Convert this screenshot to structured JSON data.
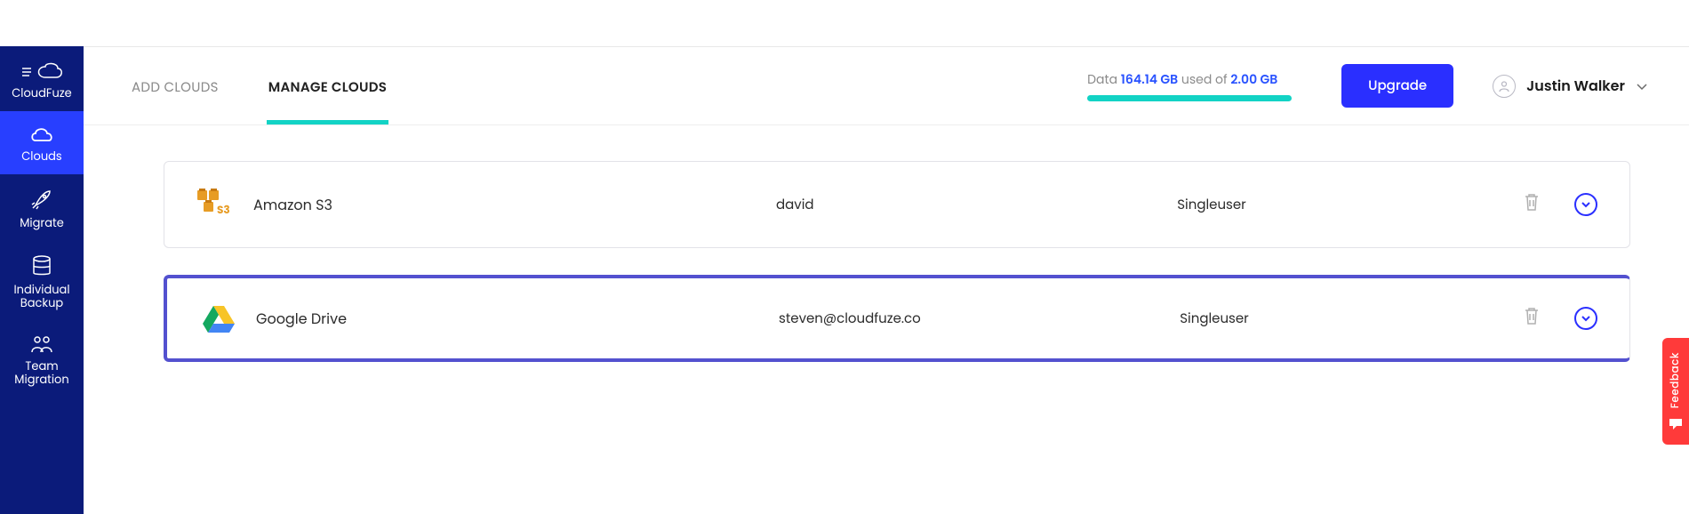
{
  "brand": "CloudFuze",
  "sidebar": {
    "items": [
      {
        "label": "CloudFuze"
      },
      {
        "label": "Clouds"
      },
      {
        "label": "Migrate"
      },
      {
        "label": "Individual Backup"
      },
      {
        "label": "Team Migration"
      }
    ]
  },
  "tabs": {
    "add": "ADD CLOUDS",
    "manage": "MANAGE CLOUDS"
  },
  "dataUsage": {
    "prefix": "Data ",
    "used": "164.14 GB",
    "mid": " used of ",
    "total": "2.00 GB"
  },
  "upgradeLabel": "Upgrade",
  "user": {
    "name": "Justin Walker"
  },
  "clouds": [
    {
      "name": "Amazon S3",
      "account": "david",
      "type": "Singleuser"
    },
    {
      "name": "Google Drive",
      "account": "steven@cloudfuze.co",
      "type": "Singleuser"
    }
  ],
  "feedbackLabel": "Feedback"
}
